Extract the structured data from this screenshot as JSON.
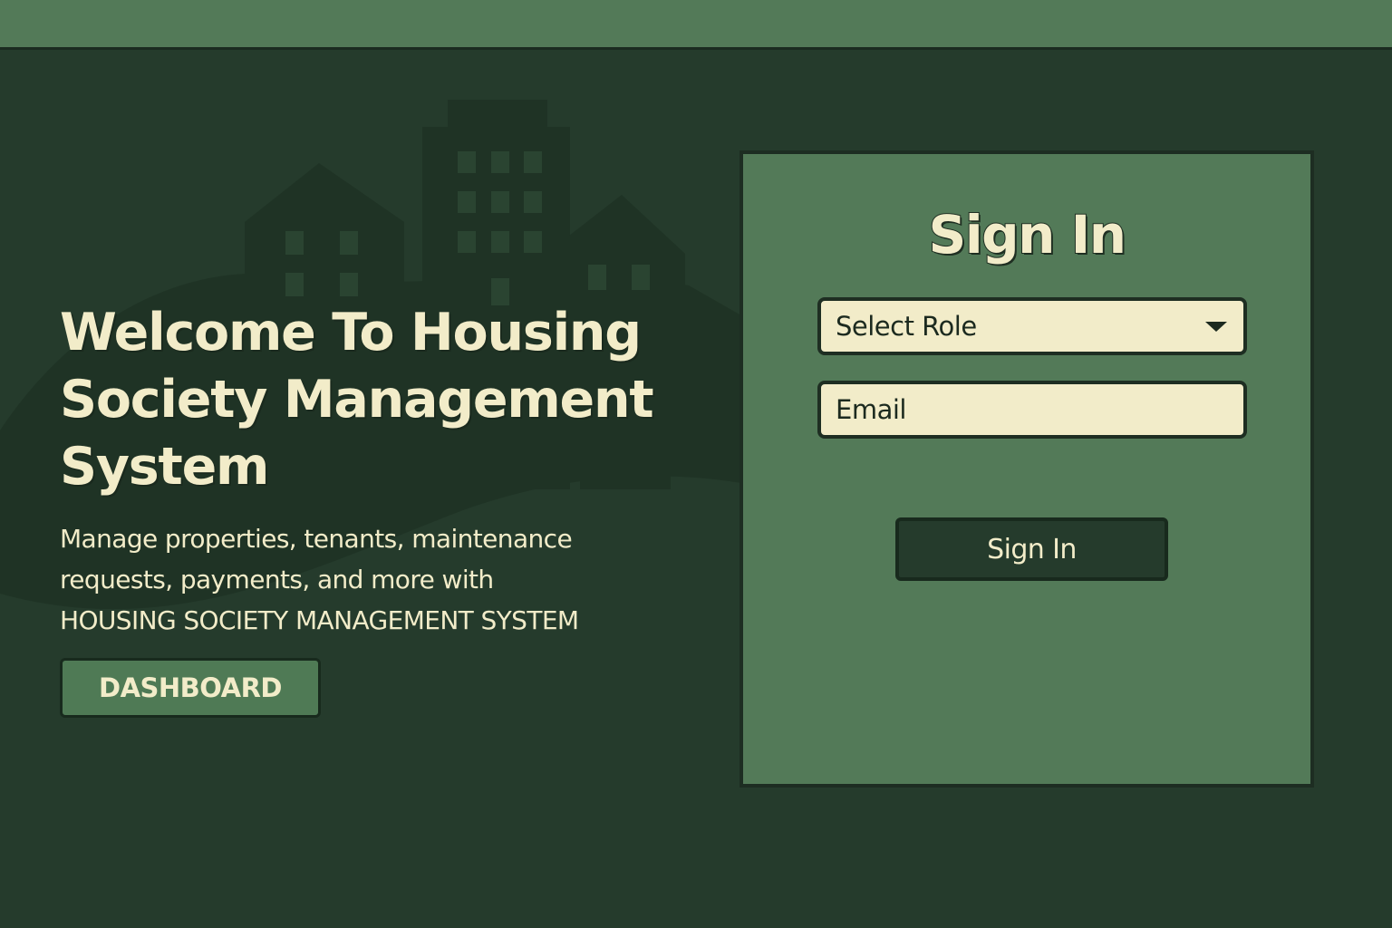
{
  "hero": {
    "title_lines": [
      "Welcome To Housing",
      "Society Management",
      "System"
    ],
    "description_lines": [
      "Manage properties, tenants, maintenance",
      "requests, payments, and more with",
      "HOUSING SOCIETY MANAGEMENT SYSTEM"
    ],
    "dashboard_label": "DASHBOARD"
  },
  "signin": {
    "title": "Sign In",
    "role_select": {
      "selected": "Select Role",
      "icon": "chevron-down-icon"
    },
    "email": {
      "placeholder": "Email",
      "value": ""
    },
    "button_label": "Sign In"
  },
  "colors": {
    "background": "#253b2c",
    "top_bar": "#537a58",
    "card": "#537a58",
    "cream_text": "#f2ecc9",
    "dark_outline": "#1b2b20",
    "skyline_shadow": "#1f3325"
  },
  "illustration": {
    "icon": "city-skyline-icon"
  }
}
